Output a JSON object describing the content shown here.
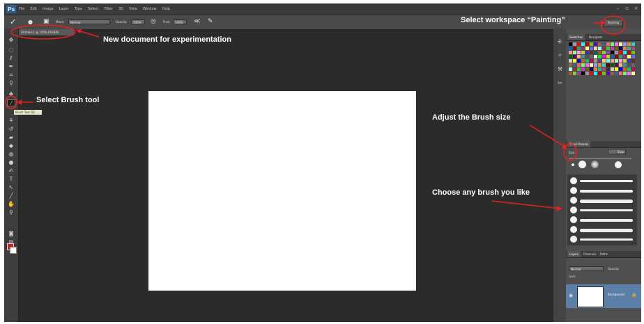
{
  "app": {
    "logo": "Ps"
  },
  "menu": [
    "File",
    "Edit",
    "Image",
    "Layer",
    "Type",
    "Select",
    "Filter",
    "3D",
    "View",
    "Window",
    "Help"
  ],
  "window_controls": [
    "–",
    "▫",
    "×"
  ],
  "options_bar": {
    "tool_icon": "brush-icon",
    "mode_label": "Mode:",
    "mode_value": "Normal",
    "opacity_label": "Opacity:",
    "opacity_value": "100%",
    "flow_label": "Flow:",
    "flow_value": "100%",
    "workspace_value": "Painting"
  },
  "document_tab": "Untitled-1 @ 100% (RGB/8)",
  "tools": {
    "brush_tooltip": "Brush Tool (B)",
    "foreground_color": "#d01c1c",
    "background_color": "#ffffff"
  },
  "panels": {
    "swatches_tabs": [
      "Swatches",
      "Navigator"
    ],
    "brush_presets_title": "Brush Presets",
    "size_label": "Size:",
    "size_value": "8 px",
    "layers_tabs": [
      "Layers",
      "Channels",
      "Paths"
    ],
    "blend_mode": "Normal",
    "opacity_label": "Opacity:",
    "lock_label": "Lock:",
    "layer_name": "Background"
  },
  "annotations": {
    "new_document": "New document for experimentation",
    "brush_tool": "Select Brush tool",
    "workspace": "Select workspace “Painting”",
    "brush_size": "Adjust the Brush size",
    "choose_brush": "Choose any brush you like"
  },
  "colors": {
    "annotation_red": "#e0231f",
    "accent_blue": "#5b7fa6"
  }
}
